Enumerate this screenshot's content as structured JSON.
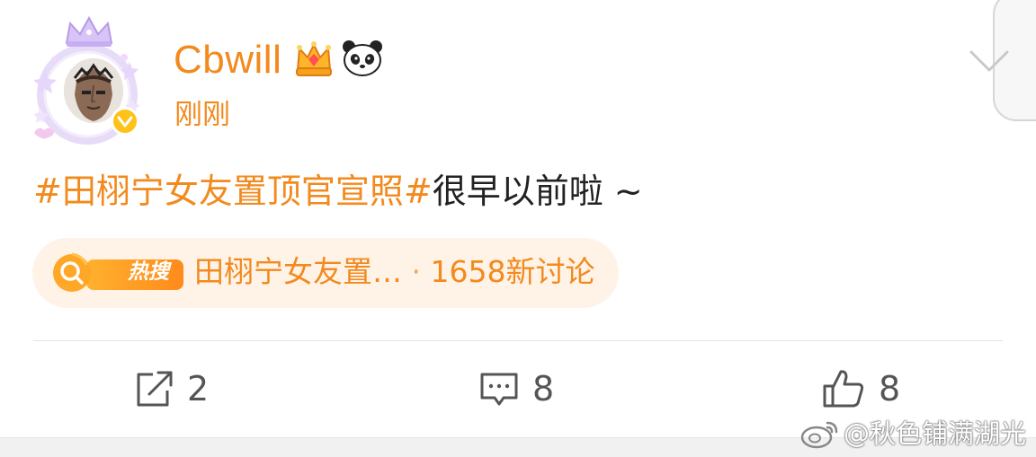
{
  "post": {
    "username": "Cbwill",
    "timestamp": "刚刚",
    "topic_text": "#田栩宁女友置顶官宣照#",
    "body_text": "很早以前啦 ~",
    "badges": [
      "crown-icon",
      "panda-icon"
    ],
    "verified": true
  },
  "hot_search": {
    "tag": "热搜",
    "title": "田栩宁女友置…",
    "separator": "·",
    "discussions": "1658新讨论"
  },
  "actions": {
    "share_count": "2",
    "comment_count": "8",
    "like_count": "8"
  },
  "watermark": {
    "text": "@秋色铺满湖光"
  },
  "colors": {
    "accent": "#f28a1e",
    "pill_bg": "#fff3e8",
    "text": "#222222",
    "icon": "#555555"
  }
}
